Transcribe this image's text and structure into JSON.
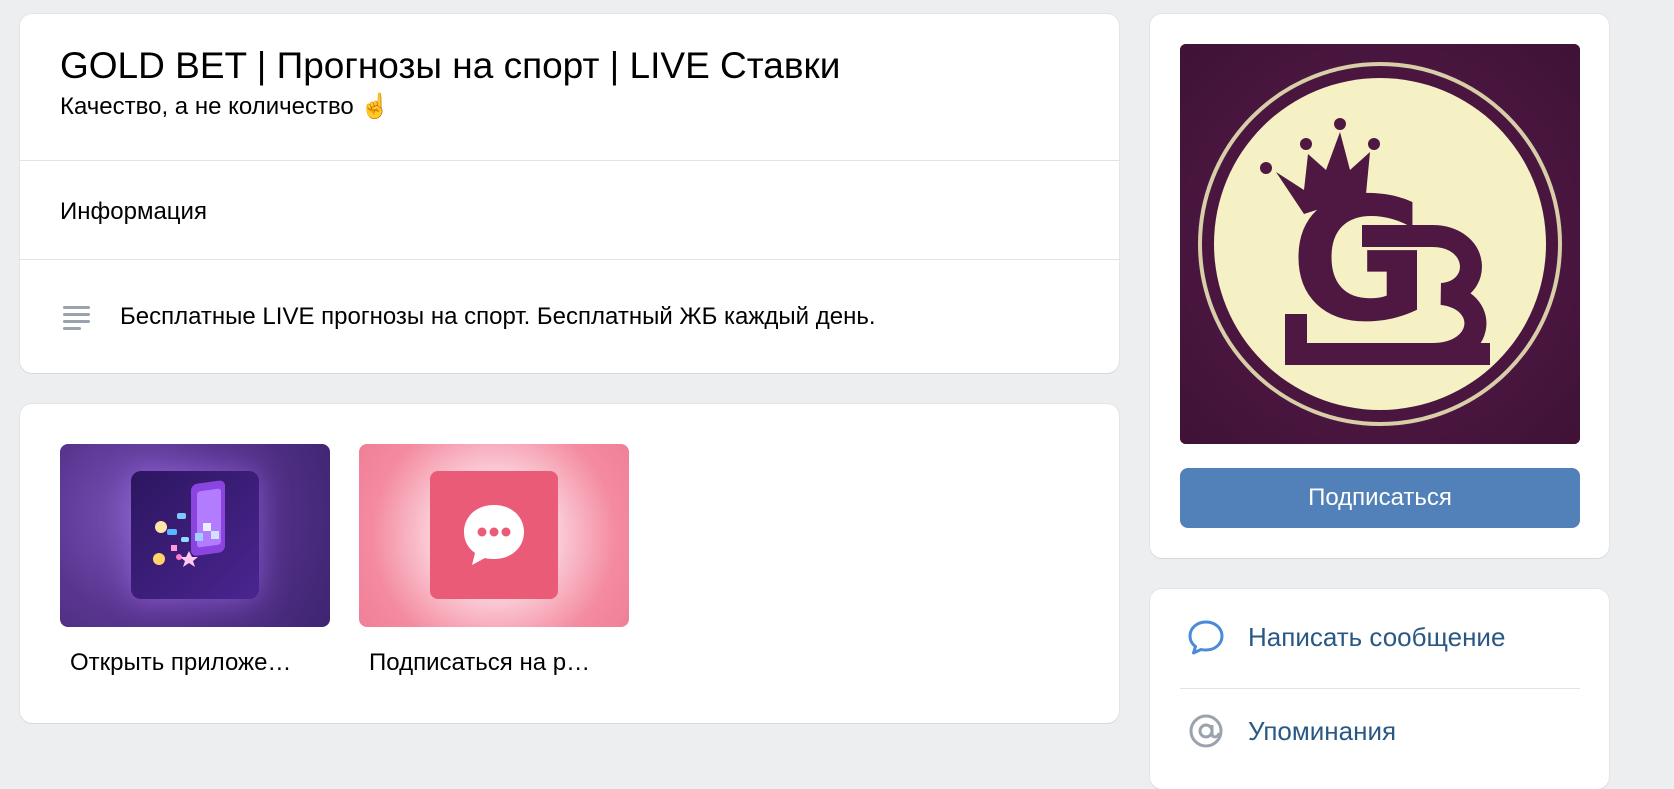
{
  "group": {
    "title": "GOLD BET | Прогнозы на спорт | LIVE Ставки",
    "status": "Качество, а не количество ☝️"
  },
  "info": {
    "section_label": "Информация",
    "description": "Бесплатные LIVE прогнозы на спорт. Бесплатный ЖБ каждый день.",
    "description_icon": "text-lines-icon"
  },
  "apps": [
    {
      "label": "Открыть приложе…",
      "icon": "app-store-icon"
    },
    {
      "label": "Подписаться на р…",
      "icon": "chat-bubble-icon"
    }
  ],
  "avatar": {
    "logo_text": "GB",
    "icon": "crown-icon"
  },
  "actions": {
    "subscribe_label": "Подписаться",
    "items": [
      {
        "label": "Написать сообщение",
        "icon": "message-icon"
      },
      {
        "label": "Упоминания",
        "icon": "at-icon"
      }
    ]
  },
  "colors": {
    "accent": "#5181b8",
    "link": "#2a5885",
    "background": "#edeef0",
    "logo_bg": "#4e1842",
    "logo_circle": "#f7f2c3"
  }
}
